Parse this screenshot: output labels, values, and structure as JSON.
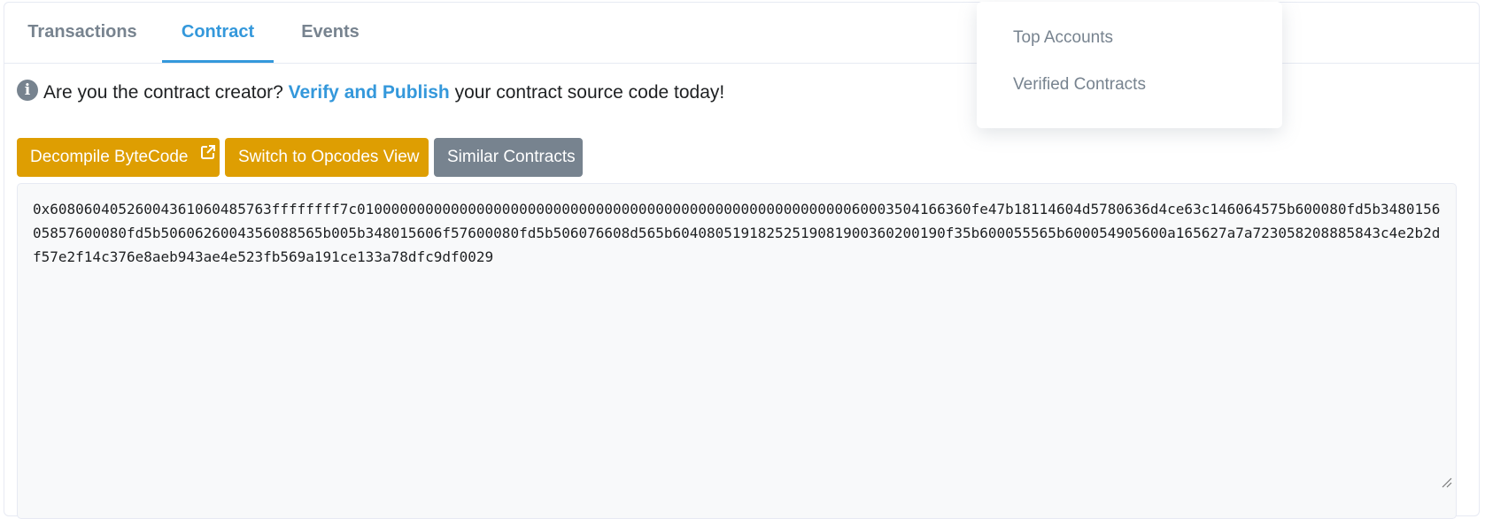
{
  "tabs": [
    {
      "label": "Transactions",
      "active": false
    },
    {
      "label": "Contract",
      "active": true
    },
    {
      "label": "Events",
      "active": false
    }
  ],
  "info": {
    "icon": "info-circle-icon",
    "prefix": "Are you the contract creator?",
    "link": "Verify and Publish",
    "suffix": "your contract source code today!"
  },
  "buttons": {
    "decompile": "Decompile ByteCode",
    "decompile_icon": "external-link-icon",
    "opcodes": "Switch to Opcodes View",
    "similar": "Similar Contracts"
  },
  "bytecode": "0x6080604052600436106048576 3ffffffff7c0100000000000000000000000000000000000000000000000000000000600035041663 60fe47b18114604d5780636d4ce63c146064575b600080fd5b348015605857600080fd5b50606260043560 88565b005b348015606f57600080fd5b506076608d565b60408051918252519081900360200190f35b6000 55565b600054905600a165627a7a723058208885843c4e2b2df57e2f14c376e8aeb943ae4e523fb569a19 1ce133a78dfc9df0029",
  "dropdown": {
    "items": [
      "Top Accounts",
      "Verified Contracts"
    ]
  },
  "colors": {
    "accent": "#3498db",
    "warning_button": "#de9e02",
    "secondary_button": "#77838f",
    "muted_text": "#77838f"
  }
}
